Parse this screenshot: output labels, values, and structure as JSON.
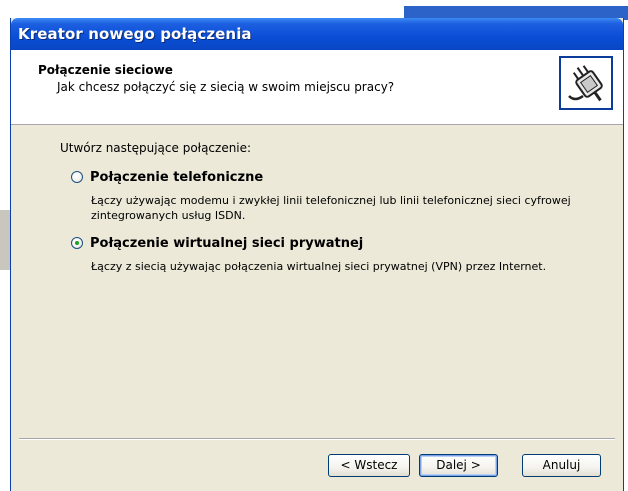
{
  "window": {
    "title": "Kreator nowego połączenia"
  },
  "header": {
    "title": "Połączenie sieciowe",
    "subtitle": "Jak chcesz połączyć się z siecią w swoim miejscu pracy?"
  },
  "body": {
    "intro": "Utwórz następujące połączenie:",
    "options": [
      {
        "label": "Połączenie telefoniczne",
        "description": "Łączy używając modemu i zwykłej linii telefonicznej lub linii telefonicznej sieci cyfrowej zintegrowanych usług ISDN.",
        "selected": false
      },
      {
        "label": "Połączenie wirtualnej sieci prywatnej",
        "description": "Łączy z siecią używając połączenia wirtualnej sieci prywatnej (VPN) przez Internet.",
        "selected": true
      }
    ]
  },
  "buttons": {
    "back": "< Wstecz",
    "next": "Dalej >",
    "cancel": "Anuluj"
  },
  "icons": {
    "header": "network-plug-icon"
  },
  "colors": {
    "titlebar": "#0a4ed6",
    "dialog_bg": "#ece9d8",
    "header_bg": "#ffffff",
    "radio_dot": "#21a121"
  }
}
